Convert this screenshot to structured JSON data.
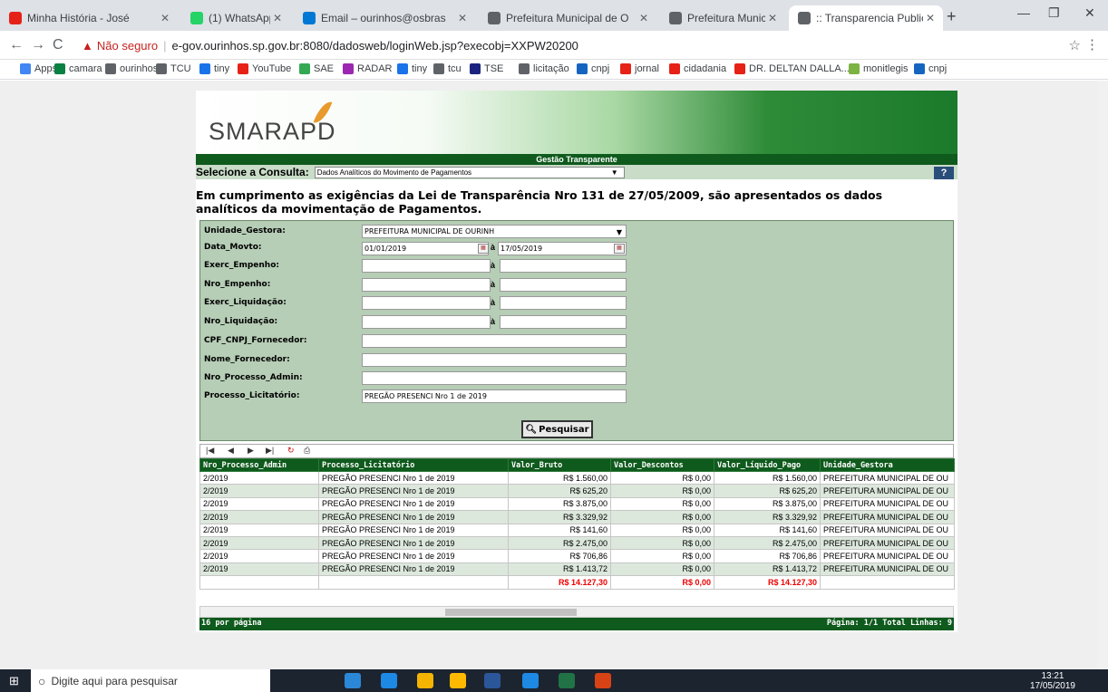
{
  "browser": {
    "tabs": [
      {
        "title": "Minha História - José",
        "color": "#e62117"
      },
      {
        "title": "(1) WhatsApp",
        "color": "#25d366"
      },
      {
        "title": "Email – ourinhos@osbras",
        "color": "#0078d4"
      },
      {
        "title": "Prefeitura Municipal de O",
        "color": "#5f6368"
      },
      {
        "title": "Prefeitura Municipal de O",
        "color": "#5f6368"
      },
      {
        "title": ":: Transparencia Publicas::",
        "color": "#5f6368"
      }
    ],
    "security_label": "Não seguro",
    "url": "e-gov.ourinhos.sp.gov.br:8080/dadosweb/loginWeb.jsp?execobj=XXPW20200",
    "bookmarks": [
      {
        "label": "Apps",
        "color": "#4285f4"
      },
      {
        "label": "camara",
        "color": "#0b8043"
      },
      {
        "label": "ourinhos",
        "color": "#5f6368"
      },
      {
        "label": "TCU",
        "color": "#5f6368"
      },
      {
        "label": "tiny",
        "color": "#1a73e8"
      },
      {
        "label": "YouTube",
        "color": "#e62117"
      },
      {
        "label": "SAE",
        "color": "#34a853"
      },
      {
        "label": "RADAR",
        "color": "#9c27b0"
      },
      {
        "label": "tiny",
        "color": "#1a73e8"
      },
      {
        "label": "tcu",
        "color": "#5f6368"
      },
      {
        "label": "TSE",
        "color": "#1a237e"
      },
      {
        "label": "licitação",
        "color": "#5f6368"
      },
      {
        "label": "cnpj",
        "color": "#1565c0"
      },
      {
        "label": "jornal",
        "color": "#e62117"
      },
      {
        "label": "cidadania",
        "color": "#e62117"
      },
      {
        "label": "DR. DELTAN DALLA...",
        "color": "#e62117"
      },
      {
        "label": "monitlegis",
        "color": "#7cb342"
      },
      {
        "label": "cnpj",
        "color": "#1565c0"
      }
    ]
  },
  "page": {
    "logo": "SMARAPD",
    "gestao": "Gestão Transparente",
    "select_label": "Selecione a Consulta:",
    "select_value": "Dados Analíticos do Movimento de Pagamentos",
    "help": "?",
    "intro": "Em cumprimento as exigências da Lei de Transparência Nro 131 de 27/05/2009, são apresentados os dados analíticos da movimentação de Pagamentos.",
    "fields": {
      "unidade_label": "Unidade_Gestora:",
      "unidade_value": "PREFEITURA MUNICIPAL DE OURINH",
      "data_label": "Data_Movto:",
      "data_from": "01/01/2019",
      "data_to": "17/05/2019",
      "exerc_emp_label": "Exerc_Empenho:",
      "nro_emp_label": "Nro_Empenho:",
      "exerc_liq_label": "Exerc_Liquidação:",
      "nro_liq_label": "Nro_Liquidação:",
      "cpf_label": "CPF_CNPJ_Fornecedor:",
      "nome_label": "Nome_Fornecedor:",
      "processo_admin_label": "Nro_Processo_Admin:",
      "processo_lic_label": "Processo_Licitatório:",
      "processo_lic_value": "PREGÃO PRESENCI Nro 1 de 2019",
      "a": "à"
    },
    "search_button": "Pesquisar",
    "table": {
      "headers": [
        "Nro_Processo_Admin",
        "Processo_Licitatório",
        "Valor_Bruto",
        "Valor_Descontos",
        "Valor_Líquido_Pago",
        "Unidade_Gestora"
      ],
      "rows": [
        [
          "2/2019",
          "PREGÃO PRESENCI Nro 1 de 2019",
          "R$ 1.560,00",
          "R$ 0,00",
          "R$ 1.560,00",
          "PREFEITURA MUNICIPAL DE OU"
        ],
        [
          "2/2019",
          "PREGÃO PRESENCI Nro 1 de 2019",
          "R$ 625,20",
          "R$ 0,00",
          "R$ 625,20",
          "PREFEITURA MUNICIPAL DE OU"
        ],
        [
          "2/2019",
          "PREGÃO PRESENCI Nro 1 de 2019",
          "R$ 3.875,00",
          "R$ 0,00",
          "R$ 3.875,00",
          "PREFEITURA MUNICIPAL DE OU"
        ],
        [
          "2/2019",
          "PREGÃO PRESENCI Nro 1 de 2019",
          "R$ 3.329,92",
          "R$ 0,00",
          "R$ 3.329,92",
          "PREFEITURA MUNICIPAL DE OU"
        ],
        [
          "2/2019",
          "PREGÃO PRESENCI Nro 1 de 2019",
          "R$ 141,60",
          "R$ 0,00",
          "R$ 141,60",
          "PREFEITURA MUNICIPAL DE OU"
        ],
        [
          "2/2019",
          "PREGÃO PRESENCI Nro 1 de 2019",
          "R$ 2.475,00",
          "R$ 0,00",
          "R$ 2.475,00",
          "PREFEITURA MUNICIPAL DE OU"
        ],
        [
          "2/2019",
          "PREGÃO PRESENCI Nro 1 de 2019",
          "R$ 706,86",
          "R$ 0,00",
          "R$ 706,86",
          "PREFEITURA MUNICIPAL DE OU"
        ],
        [
          "2/2019",
          "PREGÃO PRESENCI Nro 1 de 2019",
          "R$ 1.413,72",
          "R$ 0,00",
          "R$ 1.413,72",
          "PREFEITURA MUNICIPAL DE OU"
        ]
      ],
      "totals": [
        "",
        "",
        "R$ 14.127,30",
        "R$ 0,00",
        "R$ 14.127,30",
        ""
      ]
    },
    "footer_left": "16 por página",
    "footer_right": "Página: 1/1 Total Linhas: 9"
  },
  "taskbar": {
    "search_placeholder": "Digite aqui para pesquisar",
    "time": "13:21",
    "date": "17/05/2019"
  }
}
